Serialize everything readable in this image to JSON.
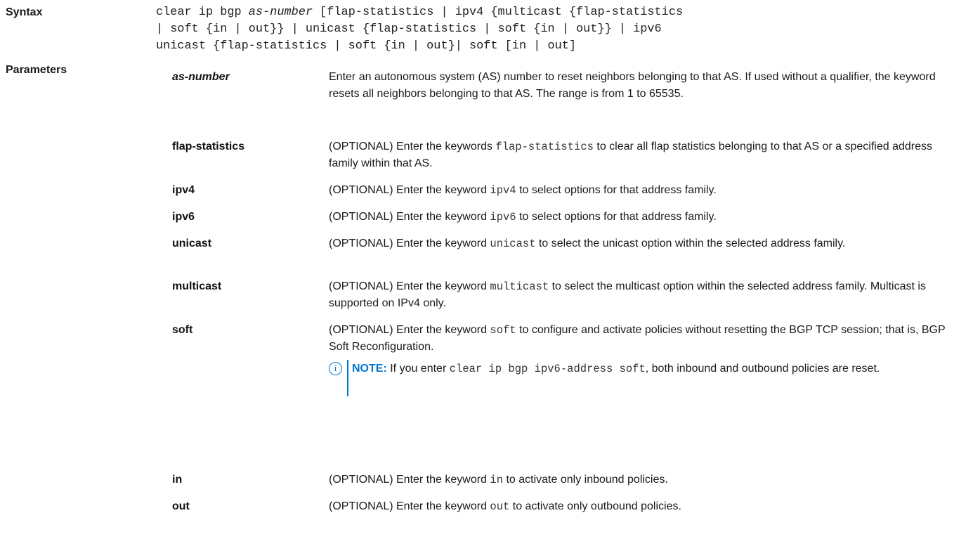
{
  "syntax": {
    "label": "Syntax",
    "line1_a": "clear ip bgp ",
    "line1_arg": "as-number",
    "line1_b": " [flap-statistics | ipv4 {multicast {flap-statistics",
    "line2": "| soft {in | out}} | unicast {flap-statistics | soft {in | out}} | ipv6",
    "line3": "unicast {flap-statistics | soft {in | out}| soft [in | out]"
  },
  "parameters": {
    "label": "Parameters",
    "items": [
      {
        "name": "as-number",
        "desc": "Enter an autonomous system (AS) number to reset neighbors belonging to that AS. If used without a qualifier, the keyword resets all neighbors belonging to that AS. The range is from 1 to 65535."
      },
      {
        "name": "flap-statistics",
        "desc_pre": "(OPTIONAL) Enter the keywords ",
        "desc_code": "flap-statistics",
        "desc_post": " to clear all flap statistics belonging to that AS or a specified address family within that AS."
      },
      {
        "name": "ipv4",
        "desc_pre": "(OPTIONAL) Enter the keyword ",
        "desc_code": "ipv4",
        "desc_post": " to select options for that address family."
      },
      {
        "name": "ipv6",
        "desc_pre": "(OPTIONAL) Enter the keyword ",
        "desc_code": "ipv6",
        "desc_post": " to select options for that address family."
      },
      {
        "name": "unicast",
        "desc_pre": "(OPTIONAL) Enter the keyword ",
        "desc_code": "unicast",
        "desc_post": " to select the unicast option within the selected address family."
      },
      {
        "name": "multicast",
        "desc_pre": "(OPTIONAL) Enter the keyword ",
        "desc_code": "multicast",
        "desc_post": " to select the multicast option within the selected address family. Multicast is supported on IPv4 only."
      },
      {
        "name": "soft",
        "desc_pre": "(OPTIONAL) Enter the keyword ",
        "desc_code": "soft",
        "desc_post": " to configure and activate policies without resetting the BGP TCP session; that is, BGP Soft Reconfiguration.",
        "note": {
          "label": "NOTE:",
          "pre": " If you enter ",
          "code": "clear ip bgp ipv6-address soft",
          "post": ", both inbound and outbound policies are reset."
        }
      },
      {
        "name": "in",
        "desc_pre": "(OPTIONAL) Enter the keyword ",
        "desc_code": "in",
        "desc_post": " to activate only inbound policies."
      },
      {
        "name": "out",
        "desc_pre": "(OPTIONAL) Enter the keyword ",
        "desc_code": "out",
        "desc_post": " to activate only outbound policies."
      }
    ]
  },
  "colors": {
    "accent": "#0076ce",
    "text": "#1a1a1a"
  },
  "icons": {
    "note": "info-icon"
  }
}
